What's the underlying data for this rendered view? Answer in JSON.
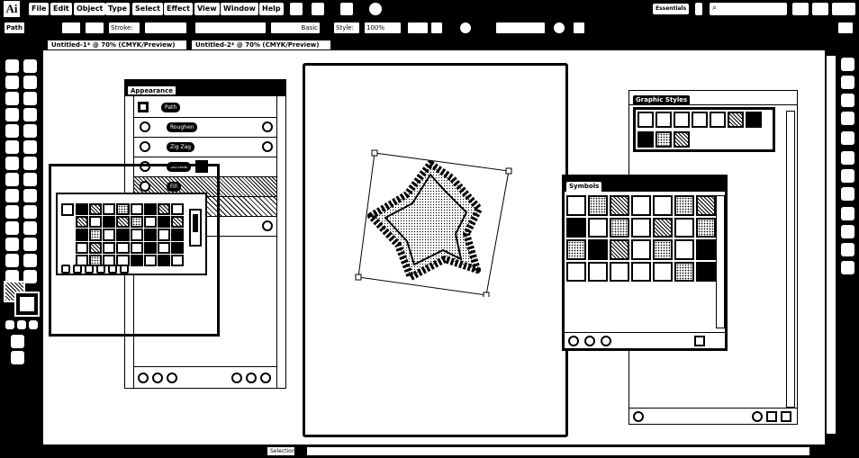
{
  "app": {
    "logo": "Ai",
    "workspace": "Essentials"
  },
  "menu": [
    "File",
    "Edit",
    "Object",
    "Type",
    "Select",
    "Effect",
    "View",
    "Window",
    "Help"
  ],
  "control_bar": {
    "selection": "Path",
    "stroke_label": "Stroke:",
    "brush_label": "Basic",
    "style_label": "Style:",
    "opacity_value": "100%"
  },
  "tabs": [
    {
      "label": "Untitled-1* @ 70% (CMYK/Preview)"
    },
    {
      "label": "Untitled-2* @ 70% (CMYK/Preview)"
    }
  ],
  "appearance_panel": {
    "tab": "Appearance",
    "object": "Path",
    "rows": [
      {
        "label": "Roughen"
      },
      {
        "label": "Zig Zag"
      },
      {
        "label": "Stroke"
      },
      {
        "label": "Fill"
      }
    ]
  },
  "graphic_styles_panel": {
    "tab": "Graphic Styles"
  },
  "symbols_panel": {
    "tab": "Symbols"
  },
  "status": {
    "zoom_box": "Selection"
  },
  "colors": {
    "chrome": "#000000",
    "canvas": "#ffffff"
  },
  "icons": [
    "search-icon",
    "minimize-icon",
    "restore-icon",
    "close-icon",
    "eye-icon",
    "new-item-icon",
    "delete-icon",
    "duplicate-icon",
    "clear-icon"
  ]
}
